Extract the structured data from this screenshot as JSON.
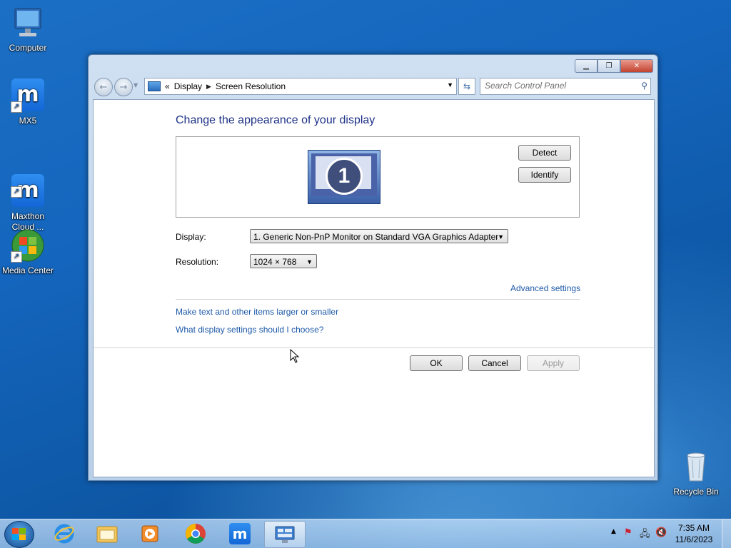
{
  "desktop": {
    "icons": [
      {
        "label": "Computer"
      },
      {
        "label": "MX5"
      },
      {
        "label": "Maxthon\nCloud ..."
      },
      {
        "label": "Media Center"
      },
      {
        "label": "Recycle Bin"
      }
    ]
  },
  "window": {
    "caption": {
      "minimize_icon": "minimize-icon",
      "restore_icon": "restore-icon",
      "close_icon": "close-icon"
    },
    "address_bar": {
      "prefix": "«",
      "crumbs": [
        "Display",
        "Screen Resolution"
      ]
    },
    "search": {
      "placeholder": "Search Control Panel"
    },
    "content": {
      "heading": "Change the appearance of your display",
      "monitor_number": "1",
      "detect_label": "Detect",
      "identify_label": "Identify",
      "display_label": "Display:",
      "display_value": "1. Generic Non-PnP Monitor on Standard VGA Graphics Adapter",
      "resolution_label": "Resolution:",
      "resolution_value": "1024 × 768",
      "advanced_link": "Advanced settings",
      "links": [
        "Make text and other items larger or smaller",
        "What display settings should I choose?"
      ],
      "ok_label": "OK",
      "cancel_label": "Cancel",
      "apply_label": "Apply"
    }
  },
  "taskbar": {
    "apps": [
      "start-orb-icon",
      "internet-explorer-icon",
      "file-explorer-icon",
      "media-player-icon",
      "chrome-icon",
      "maxthon-icon",
      "control-panel-icon"
    ],
    "clock": {
      "time": "7:35 AM",
      "date": "11/6/2023"
    }
  },
  "colors": {
    "accent": "#1e5aa8",
    "heading": "#1e3287"
  }
}
